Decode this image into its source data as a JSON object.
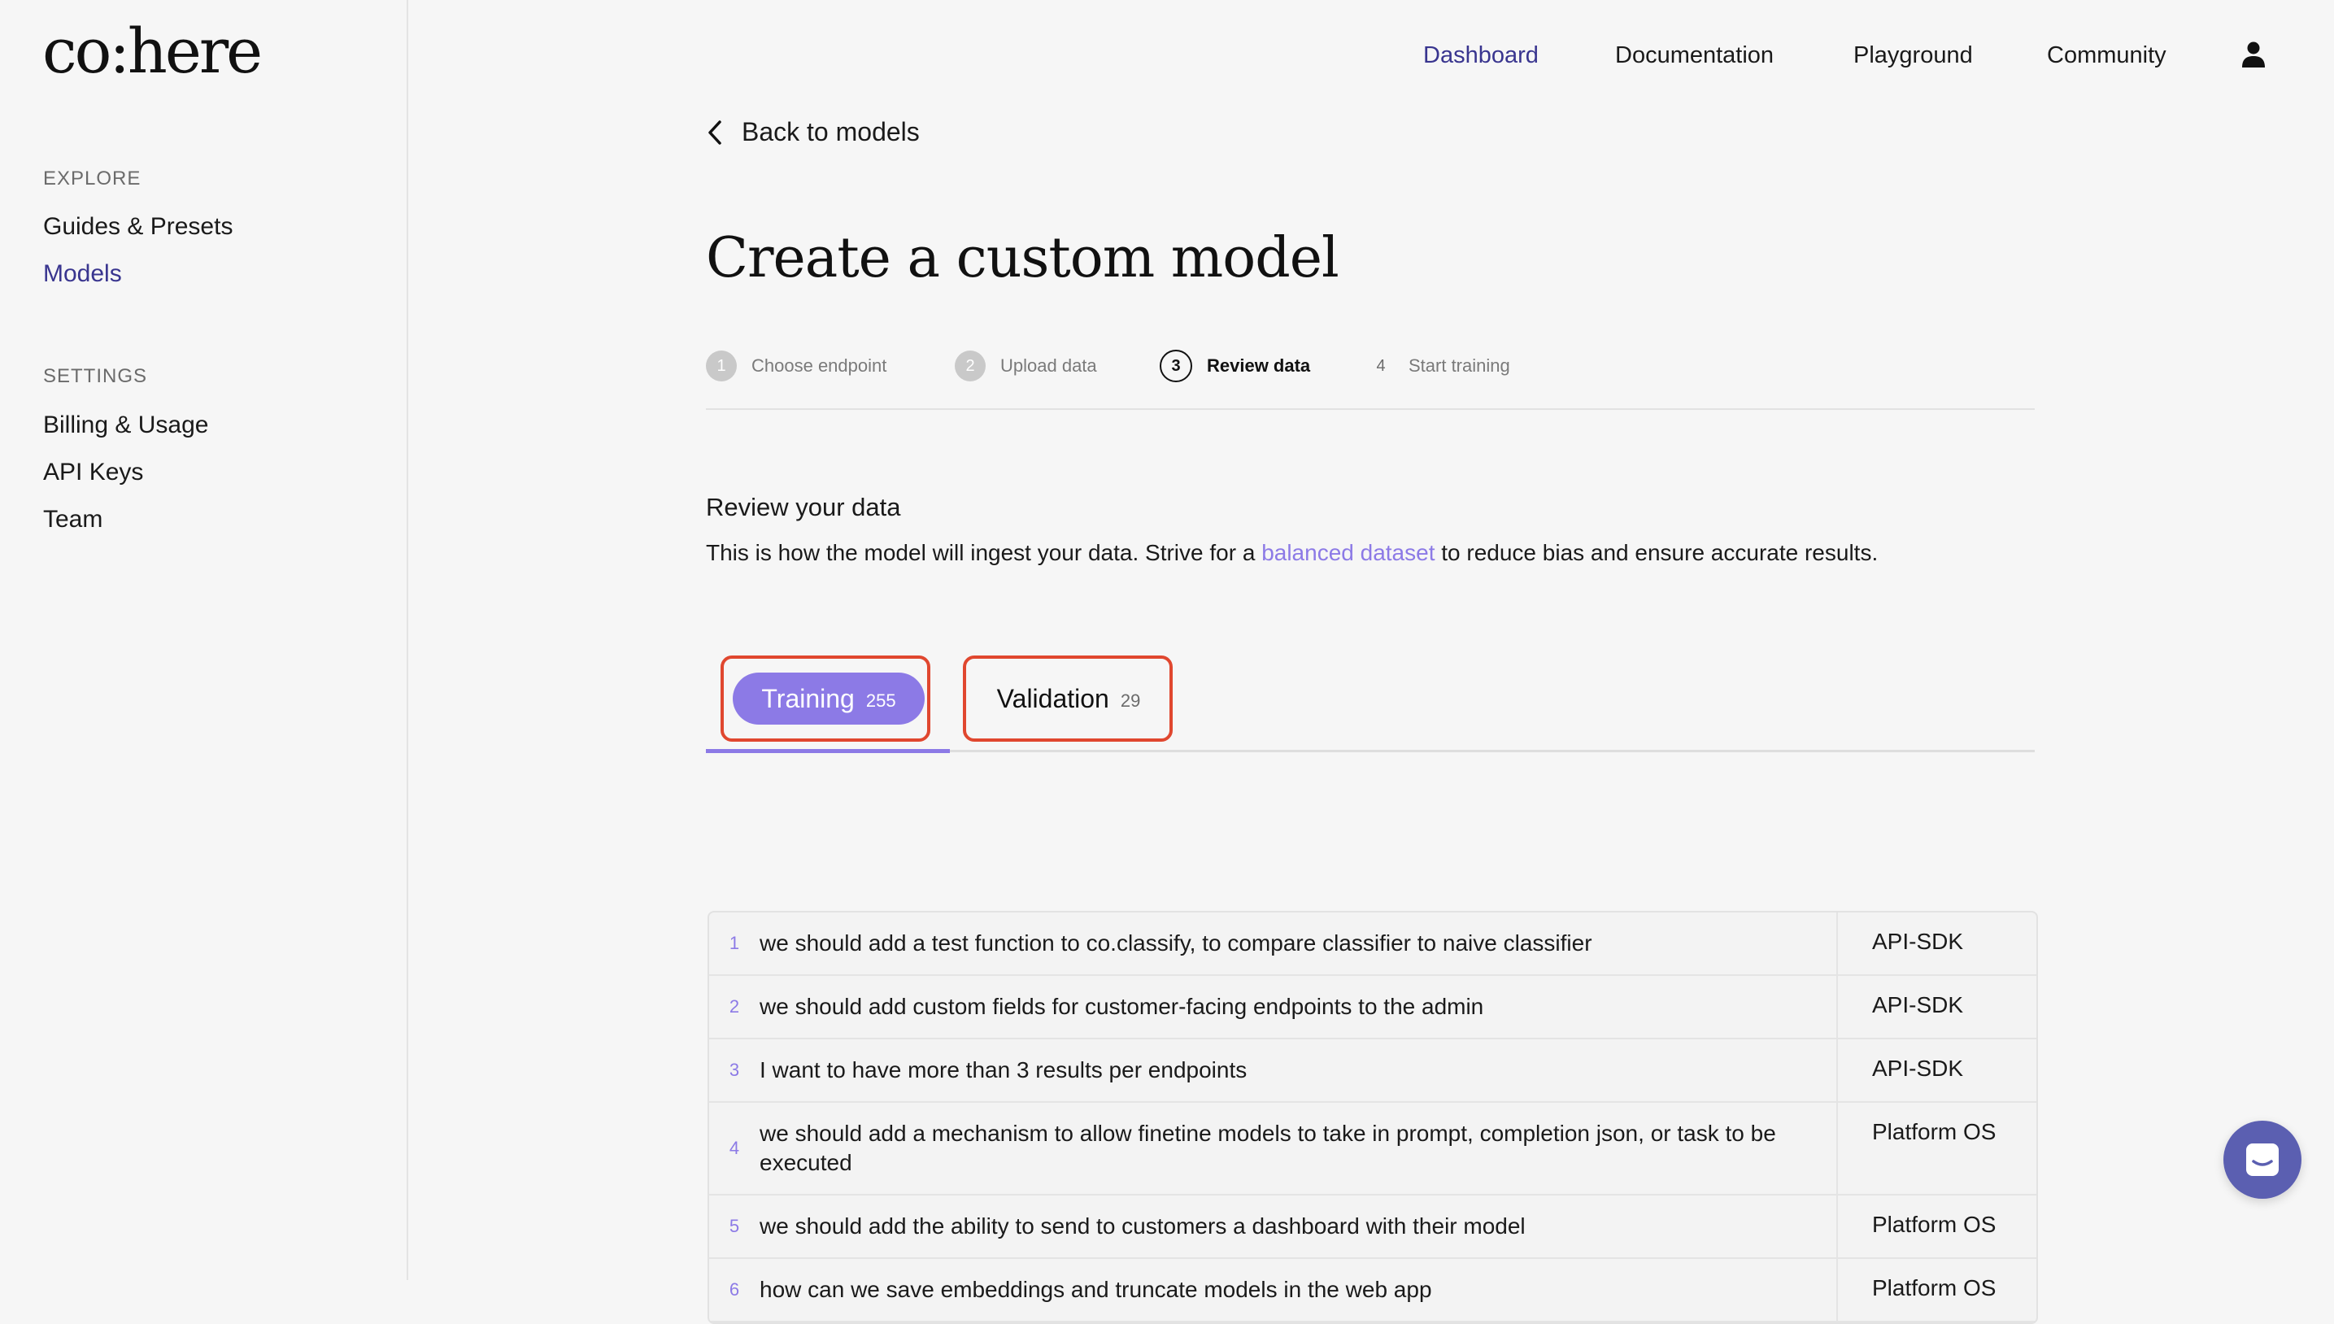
{
  "brand": {
    "logo": "co:here"
  },
  "sidebar": {
    "sections": [
      {
        "heading": "EXPLORE",
        "items": [
          {
            "label": "Guides & Presets"
          },
          {
            "label": "Models"
          }
        ]
      },
      {
        "heading": "SETTINGS",
        "items": [
          {
            "label": "Billing & Usage"
          },
          {
            "label": "API Keys"
          },
          {
            "label": "Team"
          }
        ]
      }
    ],
    "active_item": "Models"
  },
  "topnav": {
    "items": [
      {
        "label": "Dashboard"
      },
      {
        "label": "Documentation"
      },
      {
        "label": "Playground"
      },
      {
        "label": "Community"
      }
    ],
    "active_item": "Dashboard",
    "user_icon": "user-icon"
  },
  "back_link": {
    "label": "Back to models",
    "icon": "chevron-left-icon"
  },
  "page_title": "Create a custom model",
  "steps": [
    {
      "number": "1",
      "label": "Choose endpoint"
    },
    {
      "number": "2",
      "label": "Upload data"
    },
    {
      "number": "3",
      "label": "Review data"
    },
    {
      "number": "4",
      "label": "Start training"
    }
  ],
  "current_step": "3",
  "review": {
    "title": "Review your data",
    "desc_before": "This is how the model will ingest your data. Strive for a ",
    "desc_link": "balanced dataset",
    "desc_after": " to reduce bias and ensure accurate results."
  },
  "tabs": [
    {
      "label": "Training",
      "count": "255"
    },
    {
      "label": "Validation",
      "count": "29"
    }
  ],
  "active_tab": "Training",
  "table": {
    "rows": [
      {
        "index": "1",
        "text": "we should add a test function to co.classify, to compare classifier to naive classifier",
        "label": "API-SDK"
      },
      {
        "index": "2",
        "text": "we should add custom fields for customer-facing endpoints to the admin",
        "label": "API-SDK"
      },
      {
        "index": "3",
        "text": "I want to have more than 3 results per endpoints",
        "label": "API-SDK"
      },
      {
        "index": "4",
        "text": "we should add a mechanism to allow finetine models to take in prompt, completion json, or task to be executed",
        "label": "Platform OS"
      },
      {
        "index": "5",
        "text": "we should add the ability to send to customers a dashboard with their model",
        "label": "Platform OS"
      },
      {
        "index": "6",
        "text": "how can we save embeddings and truncate models in the web app",
        "label": "Platform OS"
      }
    ]
  },
  "colors": {
    "accent": "#8c7ae6",
    "active_nav": "#39358f",
    "highlight_outline": "#e0472f",
    "chat_button": "#5b5fb1"
  },
  "chat_widget": {
    "icon": "chat-icon"
  }
}
